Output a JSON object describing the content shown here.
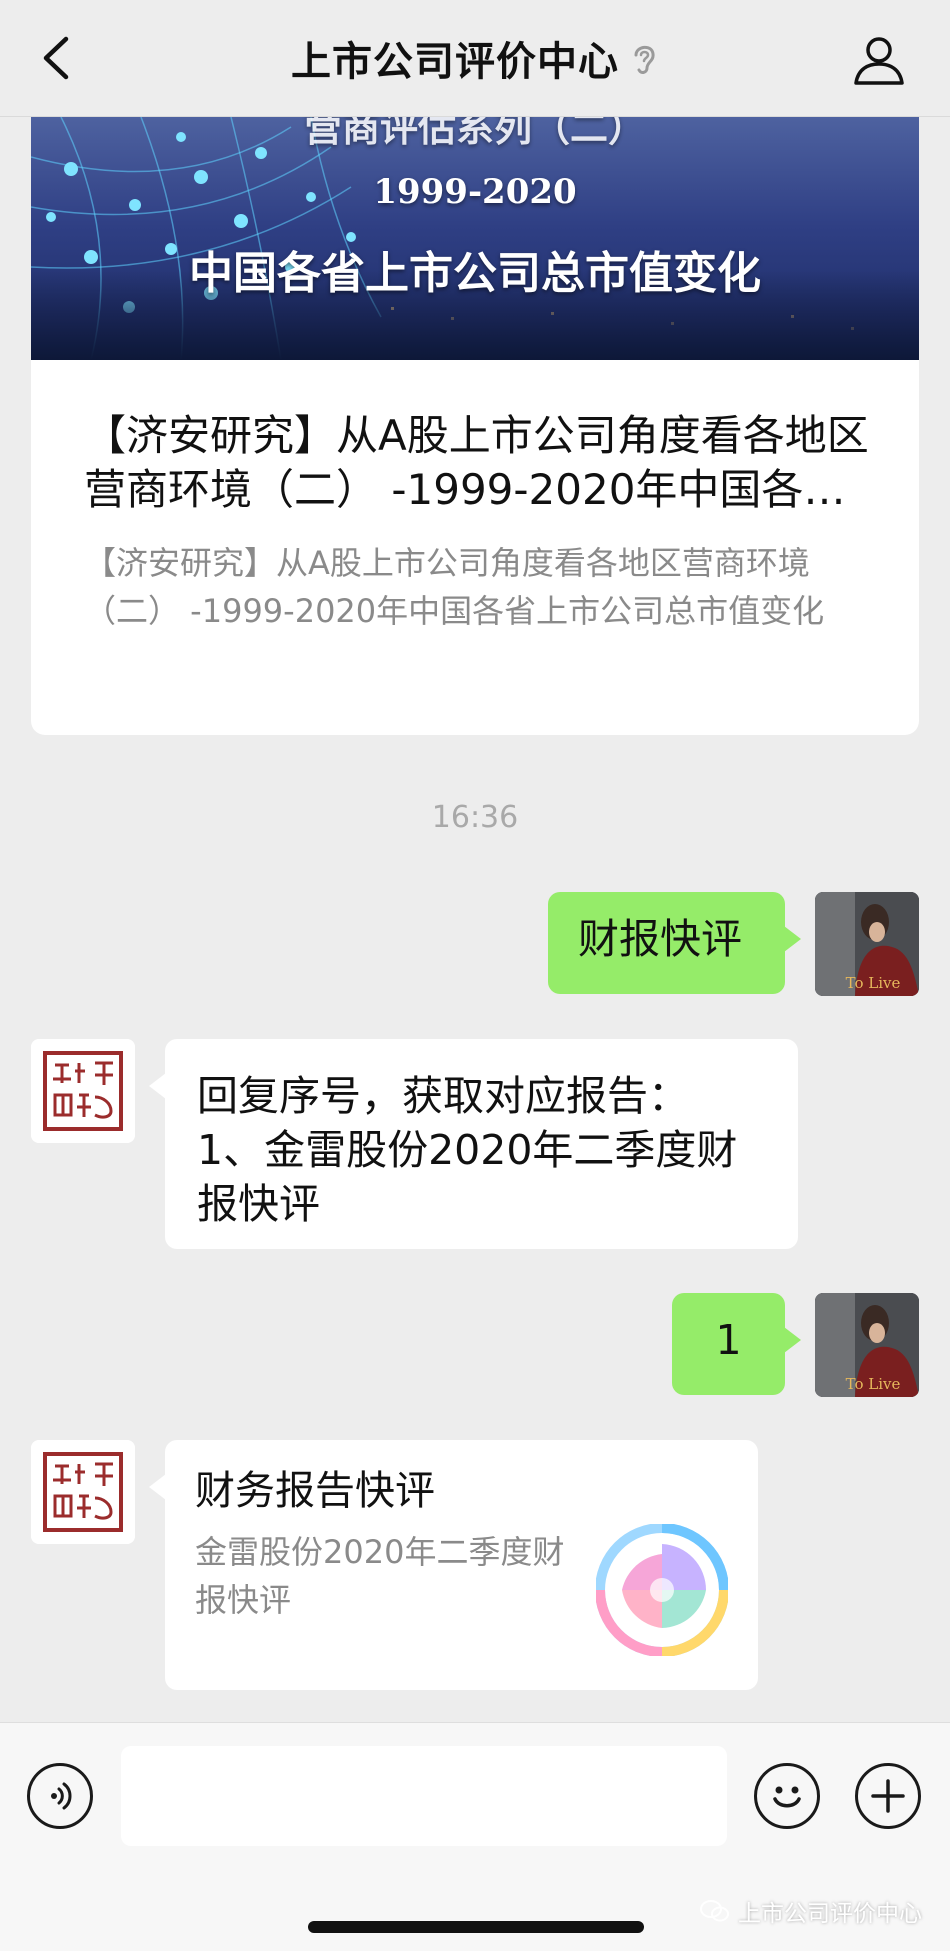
{
  "header": {
    "title": "上市公司评价中心",
    "icons": {
      "back": "chevron-left-icon",
      "ear": "ear-icon",
      "profile": "person-icon"
    }
  },
  "article": {
    "cover": {
      "series_text": "营商评估系列（二）",
      "years_text": "1999-2020",
      "headline_text": "中国各省上市公司总市值变化"
    },
    "title": "【济安研究】从A股上市公司角度看各地区营商环境（二） -1999-2020年中国各省上市公司总市值变化",
    "description": "【济安研究】从A股上市公司角度看各地区营商环境（二） -1999-2020年中国各省上市公司总市值变化"
  },
  "timestamp": "16:36",
  "messages": [
    {
      "from": "user",
      "text": "财报快评"
    },
    {
      "from": "official",
      "text": "回复序号，获取对应报告：\n1、金雷股份2020年二季度财报快评"
    },
    {
      "from": "user",
      "text": "1"
    },
    {
      "from": "official",
      "type": "mini_program",
      "title": "财务报告快评",
      "description": "金雷股份2020年二季度财报快评"
    }
  ],
  "avatars": {
    "user_poster_text": "To Live",
    "official_seal_text": "上海济安综合评价中心"
  },
  "input_bar": {
    "icons": {
      "voice": "voice-icon",
      "emoji": "emoji-icon",
      "plus": "plus-icon"
    },
    "input_value": ""
  },
  "watermark": {
    "text": "上市公司评价中心",
    "icon": "wechat-icon"
  },
  "colors": {
    "background": "#ededed",
    "sent_bubble": "#95ec69",
    "received_bubble": "#ffffff",
    "secondary_text": "#8a8a8a"
  }
}
